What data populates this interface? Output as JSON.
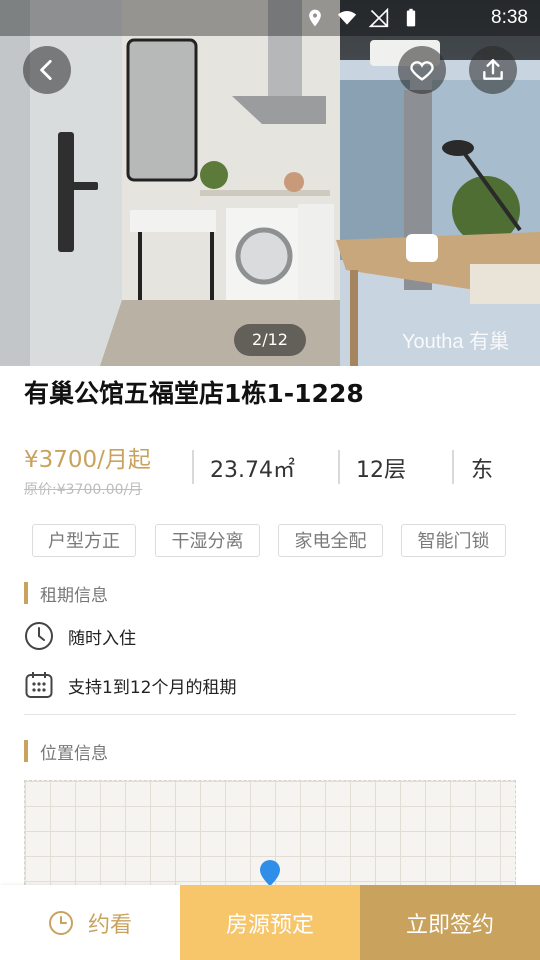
{
  "status_bar": {
    "time": "8:38",
    "icons": [
      "location-icon",
      "wifi-icon",
      "no-signal-icon",
      "battery-icon"
    ]
  },
  "gallery": {
    "counter": "2/12",
    "watermark": "Youtha 有巢"
  },
  "listing": {
    "title": "有巢公馆五福堂店1栋1-1228",
    "price": "¥3700/月起",
    "original_price": "原价:¥3700.00/月",
    "area": "23.74㎡",
    "floor": "12层",
    "orientation": "东"
  },
  "tags": [
    "户型方正",
    "干湿分离",
    "家电全配",
    "智能门锁"
  ],
  "lease_section": {
    "title": "租期信息",
    "move_in": "随时入住",
    "term": "支持1到12个月的租期"
  },
  "location_section": {
    "title": "位置信息"
  },
  "bottom_bar": {
    "view_label": "约看",
    "reserve_label": "房源预定",
    "sign_label": "立即签约"
  },
  "colors": {
    "accent": "#c9a25d",
    "reserve": "#f7c56a",
    "pin": "#2f8fe8"
  }
}
